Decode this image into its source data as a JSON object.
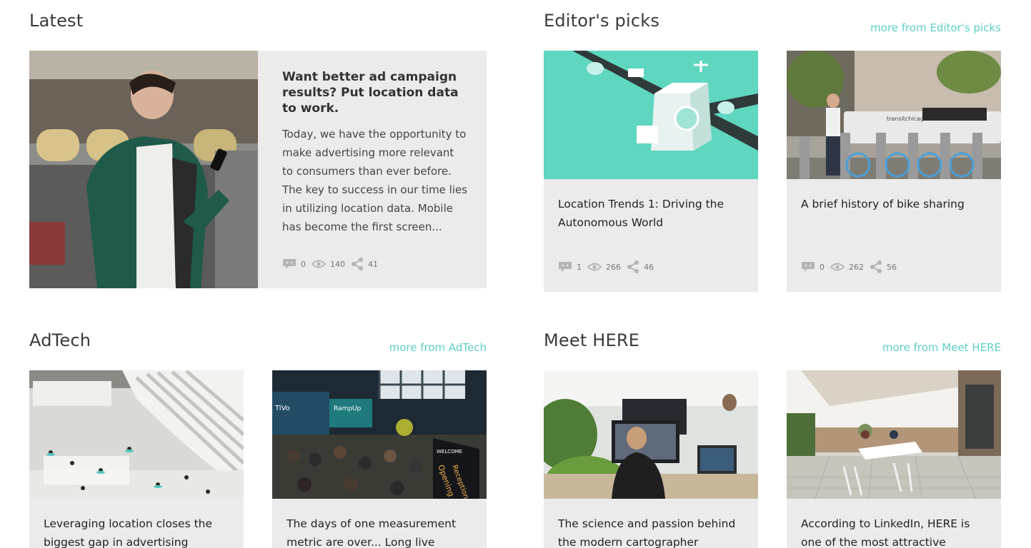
{
  "sections": {
    "latest": {
      "title": "Latest"
    },
    "editors": {
      "title": "Editor's picks",
      "more": "more from Editor's picks"
    },
    "adtech": {
      "title": "AdTech",
      "more": "more from AdTech"
    },
    "meet": {
      "title": "Meet HERE",
      "more": "more from Meet HERE"
    }
  },
  "latest_article": {
    "title": "Want better ad campaign results? Put location data to work.",
    "excerpt": "Today, we have the opportunity to make advertising more relevant to consumers than ever before. The key to success in our time lies in utilizing location data. Mobile has become the first screen...",
    "comments": "0",
    "views": "140",
    "shares": "41"
  },
  "editors_cards": [
    {
      "title": "Location Trends 1: Driving the Autonomous World",
      "comments": "1",
      "views": "266",
      "shares": "46"
    },
    {
      "title": "A brief history of bike sharing",
      "comments": "0",
      "views": "262",
      "shares": "56"
    }
  ],
  "adtech_cards": [
    {
      "title": "Leveraging location closes the biggest gap in advertising"
    },
    {
      "title": "The days of one measurement metric are over... Long live"
    }
  ],
  "meet_cards": [
    {
      "title": "The science and passion behind the modern cartographer"
    },
    {
      "title": "According to LinkedIn, HERE is one of the most attractive employers in"
    }
  ],
  "photo_text": {
    "bus_sign": "transitchicago.com",
    "tivo": "TiVo",
    "rampup": "RampUp",
    "welcome": "WELCOME",
    "opening": "Opening",
    "reception": "Reception"
  },
  "colors": {
    "accent": "#5ecfc7",
    "card_bg": "#ebebeb",
    "icon": "#b4b4b4"
  },
  "icons": {
    "comments": "speech-bubble-icon",
    "views": "eye-icon",
    "shares": "share-icon"
  }
}
